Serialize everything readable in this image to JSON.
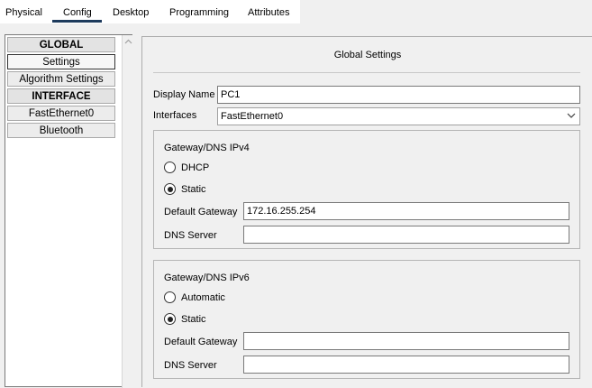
{
  "tabs": [
    {
      "label": "Physical"
    },
    {
      "label": "Config"
    },
    {
      "label": "Desktop"
    },
    {
      "label": "Programming"
    },
    {
      "label": "Attributes"
    }
  ],
  "active_tab": "Config",
  "sidebar": {
    "items": [
      {
        "label": "GLOBAL",
        "kind": "header"
      },
      {
        "label": "Settings",
        "kind": "item",
        "selected": true
      },
      {
        "label": "Algorithm Settings",
        "kind": "item"
      },
      {
        "label": "INTERFACE",
        "kind": "header"
      },
      {
        "label": "FastEthernet0",
        "kind": "item"
      },
      {
        "label": "Bluetooth",
        "kind": "item"
      }
    ]
  },
  "main": {
    "title": "Global Settings",
    "display_name_label": "Display Name",
    "display_name_value": "PC1",
    "interfaces_label": "Interfaces",
    "interfaces_value": "FastEthernet0",
    "ipv4": {
      "title": "Gateway/DNS IPv4",
      "option_dhcp": "DHCP",
      "option_static": "Static",
      "selected": "Static",
      "gateway_label": "Default Gateway",
      "gateway_value": "172.16.255.254",
      "dns_label": "DNS Server",
      "dns_value": ""
    },
    "ipv6": {
      "title": "Gateway/DNS IPv6",
      "option_auto": "Automatic",
      "option_static": "Static",
      "selected": "Static",
      "gateway_label": "Default Gateway",
      "gateway_value": "",
      "dns_label": "DNS Server",
      "dns_value": ""
    }
  },
  "colors": {
    "tab_underline": "#1d3a5c",
    "window_bg": "#f0f0f0"
  }
}
